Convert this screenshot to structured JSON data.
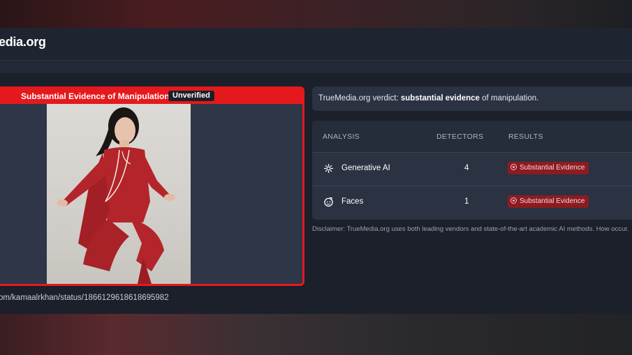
{
  "header": {
    "logo": "edia.org"
  },
  "media": {
    "verdict_label": "Substantial Evidence of Manipulation",
    "badge": "Unverified",
    "image_icon": "photo-of-woman-in-red-outfit",
    "source_url": "om/kamaalrkhan/status/1866129618618695982"
  },
  "verdict": {
    "prefix": "TrueMedia.org verdict: ",
    "emphasis": "substantial evidence",
    "suffix": " of manipulation."
  },
  "analysis": {
    "columns": [
      "ANALYSIS",
      "DETECTORS",
      "RESULTS"
    ],
    "rows": [
      {
        "icon": "generative-ai-icon",
        "label": "Generative AI",
        "detectors": "4",
        "result": "Substantial Evidence"
      },
      {
        "icon": "faces-icon",
        "label": "Faces",
        "detectors": "1",
        "result": "Substantial Evidence"
      }
    ]
  },
  "disclaimer": "Disclaimer: TrueMedia.org uses both leading vendors and state-of-the-art academic AI methods. How occur.",
  "colors": {
    "accent_red": "#e5191d",
    "badge_red": "#8a1c22",
    "panel": "#2b3242",
    "background": "#1b202b"
  }
}
